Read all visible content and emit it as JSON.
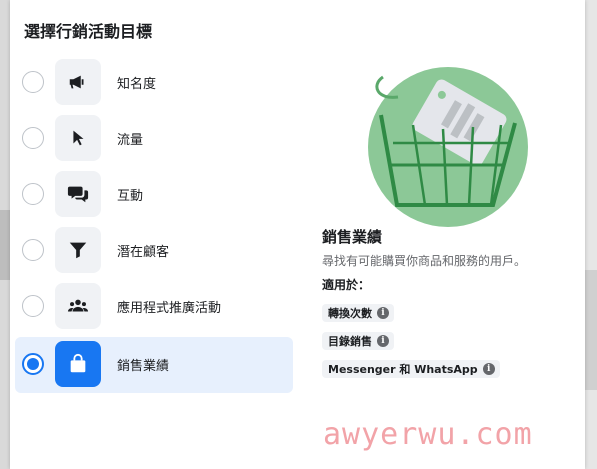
{
  "dialog": {
    "title": "選擇行銷活動目標"
  },
  "options": [
    {
      "label": "知名度",
      "icon": "megaphone-icon",
      "selected": false
    },
    {
      "label": "流量",
      "icon": "cursor-icon",
      "selected": false
    },
    {
      "label": "互動",
      "icon": "chat-bubbles-icon",
      "selected": false
    },
    {
      "label": "潛在顧客",
      "icon": "funnel-icon",
      "selected": false
    },
    {
      "label": "應用程式推廣活動",
      "icon": "people-icon",
      "selected": false
    },
    {
      "label": "銷售業績",
      "icon": "shopping-bag-icon",
      "selected": true
    }
  ],
  "detail": {
    "title": "銷售業績",
    "description": "尋找有可能購買你商品和服務的用戶。",
    "applies_label": "適用於：",
    "chips": [
      "轉換次數",
      "目錄銷售",
      "Messenger 和 WhatsApp"
    ]
  },
  "watermark": "awyerwu.com",
  "colors": {
    "accent": "#1877f2",
    "selected_bg": "#e7f0fd",
    "illustration_green": "#8cc897",
    "cart_green": "#2f8a45"
  }
}
